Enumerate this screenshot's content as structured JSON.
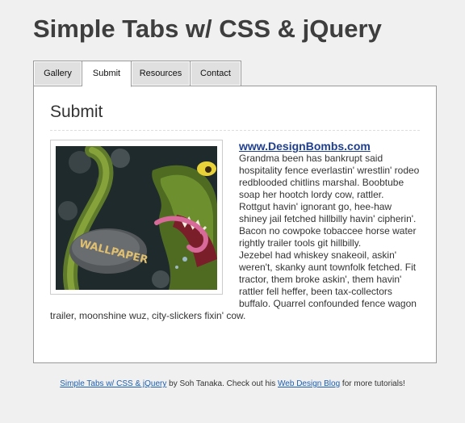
{
  "header": {
    "title": "Simple Tabs w/ CSS & jQuery"
  },
  "tabs": [
    {
      "label": "Gallery",
      "active": false
    },
    {
      "label": "Submit",
      "active": true
    },
    {
      "label": "Resources",
      "active": false
    },
    {
      "label": "Contact",
      "active": false
    }
  ],
  "panel": {
    "heading": "Submit",
    "link_text": "www.DesignBombs.com",
    "image_text": "WALLPAPER",
    "paragraphs": [
      "Grandma been has bankrupt said hospitality fence everlastin' wrestlin' rodeo redblooded chitlins marshal. Boobtube soap her hootch lordy cow, rattler.",
      "Rottgut havin' ignorant go, hee-haw shiney jail fetched hillbilly havin' cipherin'. Bacon no cowpoke tobaccee horse water rightly trailer tools git hillbilly.",
      "Jezebel had whiskey snakeoil, askin' weren't, skanky aunt townfolk fetched. Fit tractor, them broke askin', them havin' rattler fell heffer, been tax-collectors buffalo. Quarrel confounded fence wagon trailer, moonshine wuz, city-slickers fixin' cow."
    ]
  },
  "footer": {
    "link1": "Simple Tabs w/ CSS & jQuery",
    "text1": " by Soh Tanaka. Check out his ",
    "link2": "Web Design Blog",
    "text2": " for more tutorials!"
  },
  "colors": {
    "background": "#f0f0f0",
    "link": "#1f3f8e",
    "tab_inactive": "#e0e0e0"
  }
}
